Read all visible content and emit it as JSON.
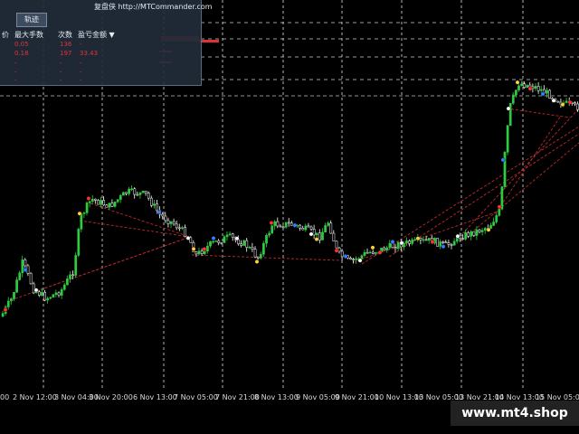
{
  "panel": {
    "title": "复盘侠 http://MTCommander.com",
    "tab": "轨迹",
    "columns": [
      "价",
      "最大手数",
      "次数",
      "盈亏金额 ▼"
    ],
    "rows": [
      [
        "0.05",
        "136",
        "-"
      ],
      [
        "0.18",
        "197",
        "33.43"
      ],
      [
        "-",
        "-",
        "-"
      ],
      [
        "-",
        "-",
        "-"
      ],
      [
        "-",
        "-",
        "-"
      ]
    ]
  },
  "time_axis": [
    "00",
    "2 Nov 12:00",
    "3 Nov 04:00",
    "3 Nov 20:00",
    "6 Nov 13:00",
    "7 Nov 05:00",
    "7 Nov 21:00",
    "8 Nov 13:00",
    "9 Nov 05:00",
    "9 Nov 21:00",
    "10 Nov 13:00",
    "13 Nov 05:00",
    "13 Nov 21:00",
    "14 Nov 13:00",
    "15 Nov 05:00"
  ],
  "brand": "www.mt4.shop",
  "colors": {
    "background": "#000000",
    "bull": "#2ecc40",
    "bear": "#ffffff",
    "grid": "#e0e0e0",
    "trade_line": "#c0282a",
    "panel_bg": "#222c3a",
    "accent_red": "#e0313a"
  },
  "chart_data": {
    "type": "line",
    "x": [
      "2 Nov",
      "3 Nov",
      "6 Nov",
      "7 Nov",
      "8 Nov",
      "9 Nov",
      "10 Nov",
      "13 Nov",
      "14 Nov",
      "15 Nov"
    ],
    "series": [
      {
        "values": [
          330,
          220,
          215,
          265,
          250,
          270,
          270,
          250,
          105,
          100
        ]
      }
    ]
  }
}
